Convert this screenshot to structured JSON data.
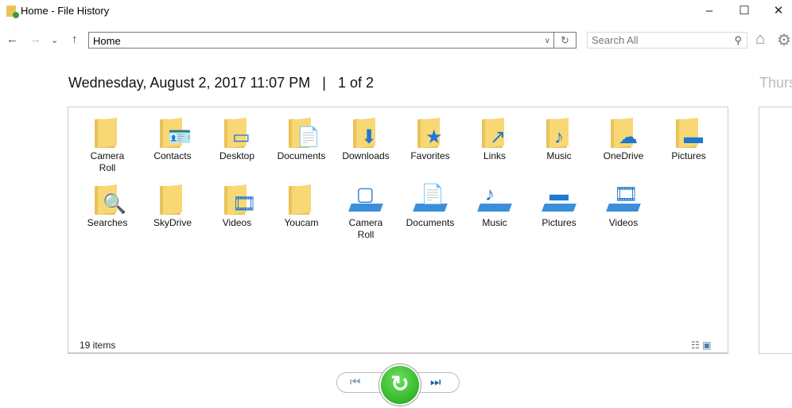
{
  "window": {
    "title": "Home - File History",
    "minimize": "–",
    "maximize": "☐",
    "close": "✕"
  },
  "toolbar": {
    "back": "←",
    "forward": "→",
    "recent": "⌄",
    "up": "↑",
    "address": "Home",
    "address_dropdown": "∨",
    "refresh": "↻",
    "search_placeholder": "Search All",
    "search_icon": "⚲",
    "home": "⌂",
    "settings": "⚙"
  },
  "header": {
    "date": "Wednesday, August 2, 2017 11:07 PM",
    "separator": "|",
    "page": "1 of 2",
    "next_date": "Thurs"
  },
  "items": [
    {
      "label": "Camera Roll",
      "type": "folder",
      "icon": "folder",
      "overlay": ""
    },
    {
      "label": "Contacts",
      "type": "folder",
      "icon": "contacts-folder",
      "overlay": "🪪"
    },
    {
      "label": "Desktop",
      "type": "folder",
      "icon": "desktop-folder",
      "overlay": "▭"
    },
    {
      "label": "Documents",
      "type": "folder",
      "icon": "documents-folder",
      "overlay": "📄"
    },
    {
      "label": "Downloads",
      "type": "folder",
      "icon": "downloads-folder",
      "overlay": "⬇"
    },
    {
      "label": "Favorites",
      "type": "folder",
      "icon": "favorites-folder",
      "overlay": "★"
    },
    {
      "label": "Links",
      "type": "folder",
      "icon": "links-folder",
      "overlay": "↗"
    },
    {
      "label": "Music",
      "type": "folder",
      "icon": "music-folder",
      "overlay": "♪"
    },
    {
      "label": "OneDrive",
      "type": "folder",
      "icon": "onedrive-folder",
      "overlay": "☁"
    },
    {
      "label": "Pictures",
      "type": "folder",
      "icon": "pictures-folder",
      "overlay": "▬"
    },
    {
      "label": "Searches",
      "type": "folder",
      "icon": "searches-folder",
      "overlay": "🔍"
    },
    {
      "label": "SkyDrive",
      "type": "folder",
      "icon": "folder",
      "overlay": ""
    },
    {
      "label": "Videos",
      "type": "folder",
      "icon": "videos-folder",
      "overlay": "🎞"
    },
    {
      "label": "Youcam",
      "type": "folder",
      "icon": "folder",
      "overlay": ""
    },
    {
      "label": "Camera Roll",
      "type": "library",
      "icon": "camera-roll-library",
      "overlay": "▢"
    },
    {
      "label": "Documents",
      "type": "library",
      "icon": "documents-library",
      "overlay": "📄"
    },
    {
      "label": "Music",
      "type": "library",
      "icon": "music-library",
      "overlay": "♪"
    },
    {
      "label": "Pictures",
      "type": "library",
      "icon": "pictures-library",
      "overlay": "▬"
    },
    {
      "label": "Videos",
      "type": "library",
      "icon": "videos-library",
      "overlay": "🎞"
    }
  ],
  "status": {
    "count": "19 items",
    "details_view": "☷",
    "large_icons_view": "▣"
  },
  "controls": {
    "previous": "⏮",
    "restore": "↻",
    "next": "⏭"
  },
  "colors": {
    "restore_green": "#2db32a",
    "folder": "#f8d775",
    "library_blue": "#3b8fd8"
  }
}
